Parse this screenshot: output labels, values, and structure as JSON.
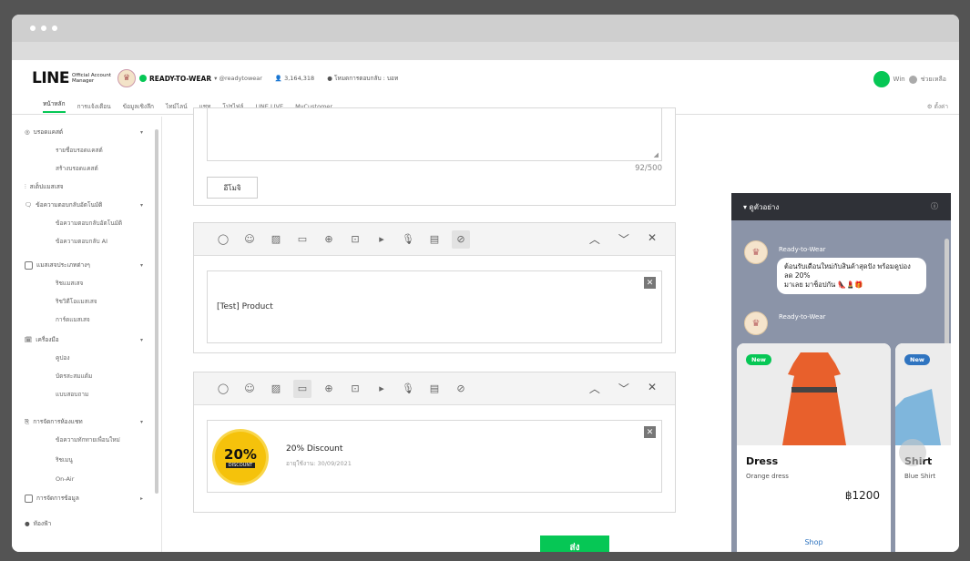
{
  "header": {
    "logo": "LINE",
    "logo_sub": "Official Account Manager",
    "account_name": "READY-TO-WEAR",
    "account_id": "▾ @readytowear",
    "followers": "3,164,318",
    "plan": "โหมดการตอบกลับ : บอท",
    "user": "Win",
    "help": "ช่วยเหลือ"
  },
  "nav": {
    "items": [
      "หน้าหลัก",
      "การแจ้งเตือน",
      "ข้อมูลเชิงลึก",
      "ไทม์ไลน์",
      "แชท",
      "โปรไฟล์",
      "LINE LIVE",
      "MyCustomer"
    ],
    "settings": "ตั้งค่า"
  },
  "sidebar": {
    "groups": [
      {
        "label": "บรอดแคสต์",
        "subs": [
          "รายชื่อบรอดแคสต์",
          "สร้างบรอดแคสต์"
        ]
      },
      {
        "label": "สเต็ปแมสเสจ",
        "subs": []
      },
      {
        "label": "ข้อความตอบกลับอัตโนมัติ",
        "subs": [
          "ข้อความตอบกลับอัตโนมัติ",
          "ข้อความตอบกลับ AI"
        ]
      },
      {
        "label": "แมสเสจประเภทต่างๆ",
        "subs": [
          "ริชแมสเสจ",
          "ริชวิดีโอแมสเสจ",
          "การ์ดแมสเสจ"
        ]
      },
      {
        "label": "เครื่องมือ",
        "subs": [
          "คูปอง",
          "บัตรสะสมแต้ม",
          "แบบสอบถาม"
        ]
      },
      {
        "label": "การจัดการห้องแชท",
        "subs": [
          "ข้อความทักทายเพื่อนใหม่",
          "ริชเมนู",
          "On-Air"
        ]
      },
      {
        "label": "การจัดการข้อมูล",
        "subs": []
      }
    ],
    "footer": "ท้องฟ้า"
  },
  "composer": {
    "char_count": "92/500",
    "emoji_button": "อีโมจิ",
    "block2_text": "[Test] Product",
    "coupon_title": "20% Discount",
    "coupon_expiry": "อายุใช้งาน: 30/09/2021",
    "coupon_badge_big": "20%",
    "coupon_badge_small": "DISCOUNT",
    "send": "ส่ง"
  },
  "preview": {
    "title": "▾ ดูตัวอย่าง",
    "sender": "Ready-to-Wear",
    "message_line1": "ต้อนรับเดือนใหม่กับสินค้าสุดปัง พร้อมคูปองลด 20%",
    "message_line2": "มาเลย มาช็อปกัน 👠💄🎁",
    "cards": [
      {
        "badge": "New",
        "title": "Dress",
        "desc": "Orange dress",
        "price": "฿1200",
        "action": "Shop"
      },
      {
        "badge": "New",
        "title": "Shirt",
        "desc": "Blue Shirt"
      }
    ]
  },
  "colors": {
    "accent": "#06c755",
    "preview_bg": "#8b94a8"
  }
}
